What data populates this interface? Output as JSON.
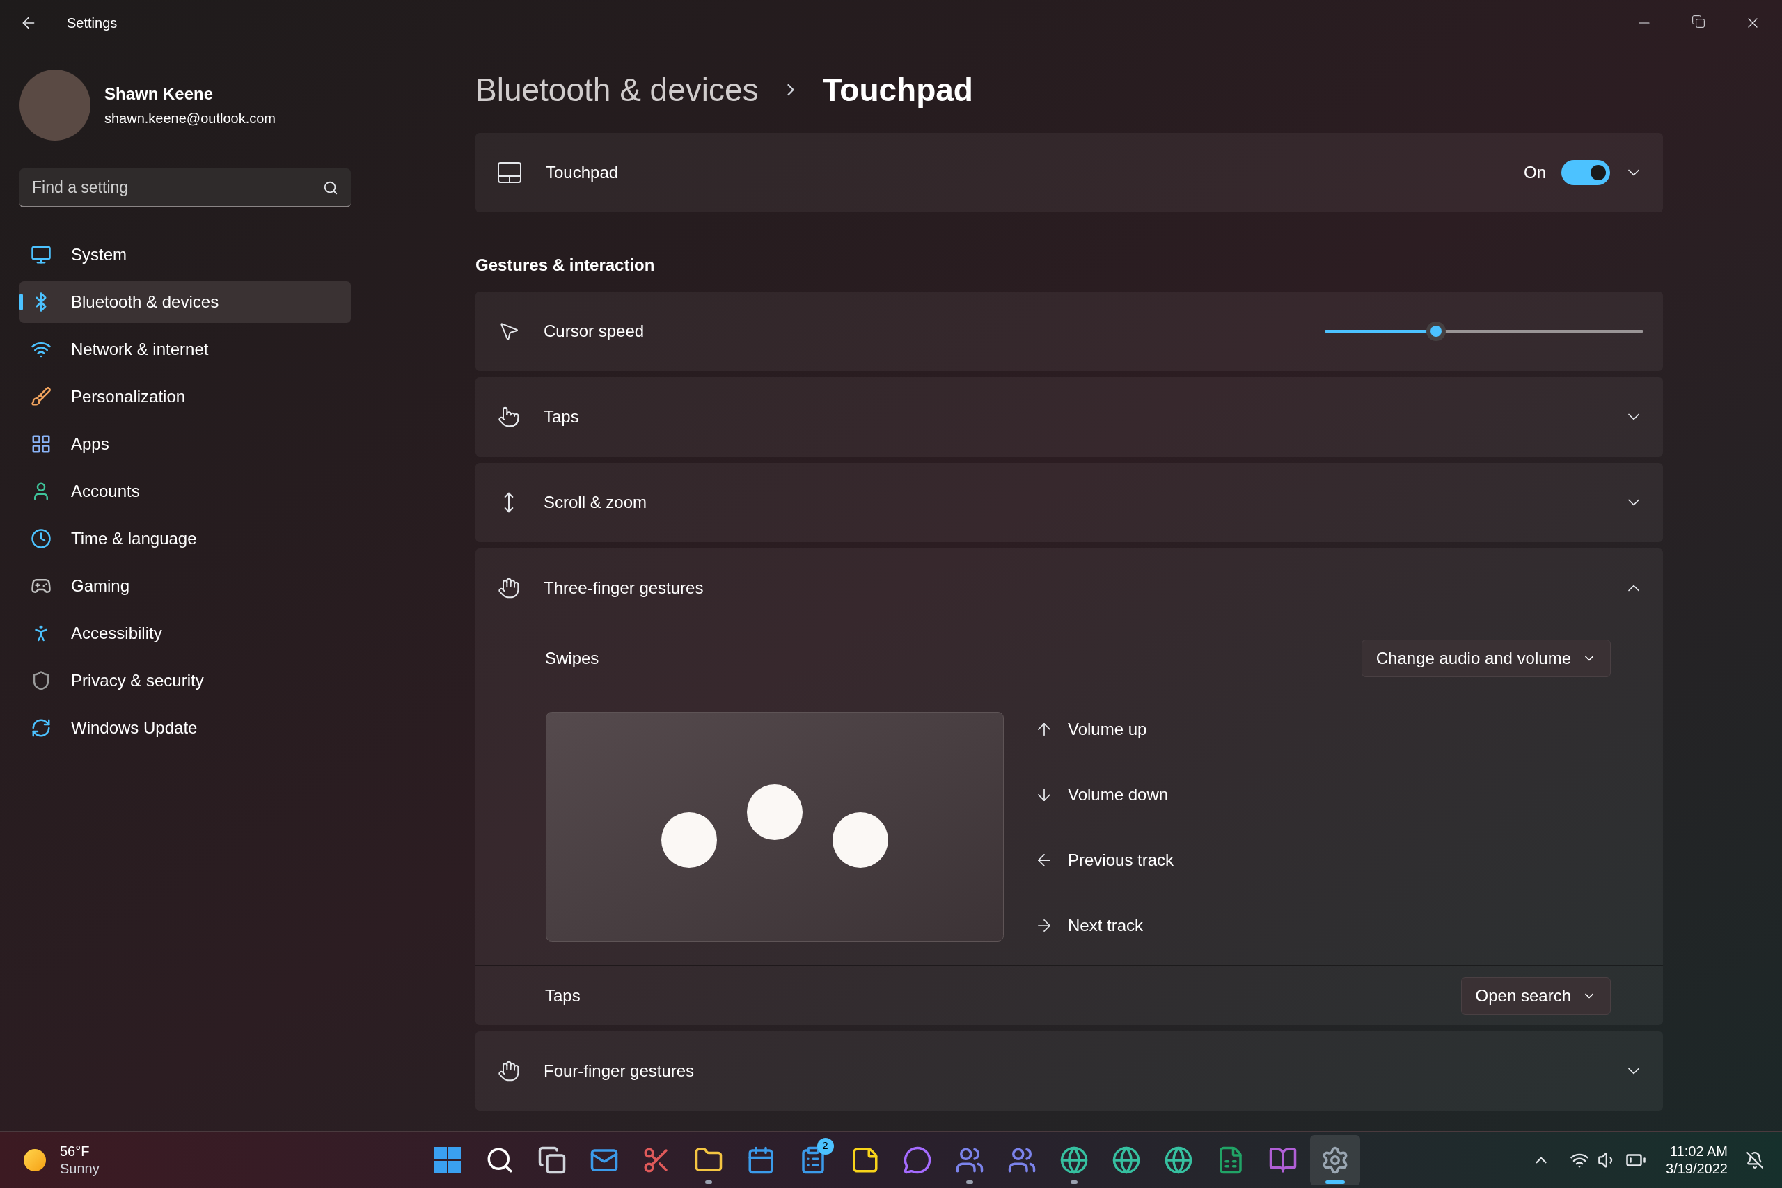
{
  "window": {
    "title": "Settings"
  },
  "user": {
    "name": "Shawn Keene",
    "email": "shawn.keene@outlook.com"
  },
  "search": {
    "placeholder": "Find a setting"
  },
  "sidebar": {
    "items": [
      {
        "label": "System",
        "selected": false
      },
      {
        "label": "Bluetooth & devices",
        "selected": true
      },
      {
        "label": "Network & internet",
        "selected": false
      },
      {
        "label": "Personalization",
        "selected": false
      },
      {
        "label": "Apps",
        "selected": false
      },
      {
        "label": "Accounts",
        "selected": false
      },
      {
        "label": "Time & language",
        "selected": false
      },
      {
        "label": "Gaming",
        "selected": false
      },
      {
        "label": "Accessibility",
        "selected": false
      },
      {
        "label": "Privacy & security",
        "selected": false
      },
      {
        "label": "Windows Update",
        "selected": false
      }
    ]
  },
  "breadcrumb": {
    "parent": "Bluetooth & devices",
    "current": "Touchpad"
  },
  "touchpad": {
    "label": "Touchpad",
    "state_text": "On",
    "on": true,
    "expanded": false
  },
  "section_title": "Gestures & interaction",
  "settings": [
    {
      "kind": "slider",
      "label": "Cursor speed",
      "level": 0.35
    },
    {
      "kind": "expander",
      "label": "Taps",
      "expanded": false
    },
    {
      "kind": "expander",
      "label": "Scroll & zoom",
      "expanded": false
    },
    {
      "kind": "expander",
      "label": "Three-finger gestures",
      "expanded": true,
      "swipes": {
        "label": "Swipes",
        "value": "Change audio and volume"
      },
      "actions": [
        {
          "label": "Volume up"
        },
        {
          "label": "Volume down"
        },
        {
          "label": "Previous track"
        },
        {
          "label": "Next track"
        }
      ],
      "taps": {
        "label": "Taps",
        "value": "Open search"
      }
    },
    {
      "kind": "expander",
      "label": "Four-finger gestures",
      "expanded": false
    }
  ],
  "taskbar": {
    "weather": {
      "temp": "56°F",
      "condition": "Sunny"
    },
    "apps": [
      {
        "running": false,
        "selected": false
      },
      {
        "running": false,
        "selected": false
      },
      {
        "running": false,
        "selected": false
      },
      {
        "running": false,
        "selected": false
      },
      {
        "running": false,
        "selected": false
      },
      {
        "running": true,
        "selected": false
      },
      {
        "running": false,
        "selected": false
      },
      {
        "running": false,
        "selected": false,
        "badge": "2"
      },
      {
        "running": false,
        "selected": false
      },
      {
        "running": false,
        "selected": false
      },
      {
        "running": true,
        "selected": false
      },
      {
        "running": false,
        "selected": false
      },
      {
        "running": true,
        "selected": false
      },
      {
        "running": false,
        "selected": false
      },
      {
        "running": false,
        "selected": false
      },
      {
        "running": false,
        "selected": false
      },
      {
        "running": false,
        "selected": false
      },
      {
        "running": true,
        "selected": true
      }
    ],
    "time": "11:02 AM",
    "date": "3/19/2022"
  }
}
